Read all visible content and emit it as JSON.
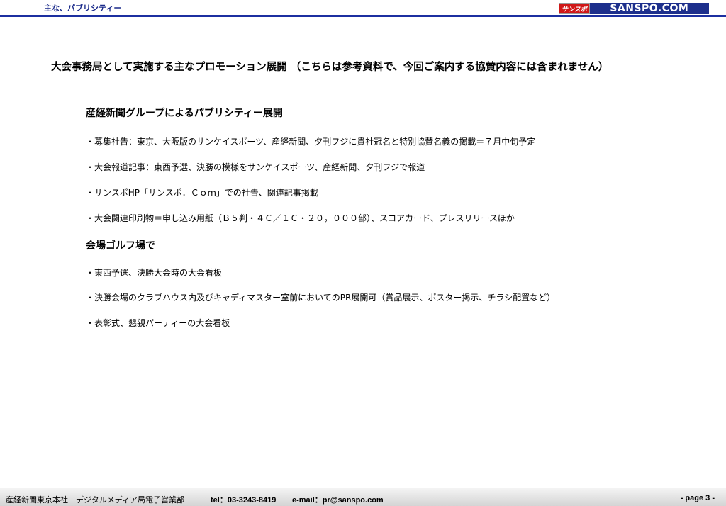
{
  "header": {
    "title": "主な、パブリシティー",
    "logo_mark": "サンスポ",
    "logo_text": "SANSPO.COM"
  },
  "main_heading": "大会事務局として実施する主なプロモーション展開 （こちらは参考資料で、今回ご案内する協賛内容には含まれません）",
  "sections": [
    {
      "heading": "産経新聞グループによるパブリシティー展開",
      "items": [
        "・募集社告：東京、大阪版のサンケイスポーツ、産経新聞、夕刊フジに貴社冠名と特別協賛名義の掲載＝７月中旬予定",
        "・大会報道記事：東西予選、決勝の模様をサンケイスポーツ、産経新聞、夕刊フジで報道",
        "・サンスポHP「サンスポ．Ｃｏｍ」での社告、関連記事掲載",
        "・大会関連印刷物＝申し込み用紙（Ｂ５判・４Ｃ／１Ｃ・２０，０００部）、スコアカード、プレスリリースほか"
      ]
    },
    {
      "heading": "会場ゴルフ場で",
      "items": [
        "・東西予選、決勝大会時の大会看板",
        "・決勝会場のクラブハウス内及びキャディマスター室前においてのPR展開可（賞品展示、ポスター掲示、チラシ配置など）",
        "・表彰式、懇親パーティーの大会看板"
      ]
    }
  ],
  "footer": {
    "org": "産経新聞東京本社　デジタルメディア局電子営業部",
    "tel": "tel：03-3243-8419",
    "email": "e-mail：pr@sanspo.com",
    "page": "- page 3 -"
  }
}
